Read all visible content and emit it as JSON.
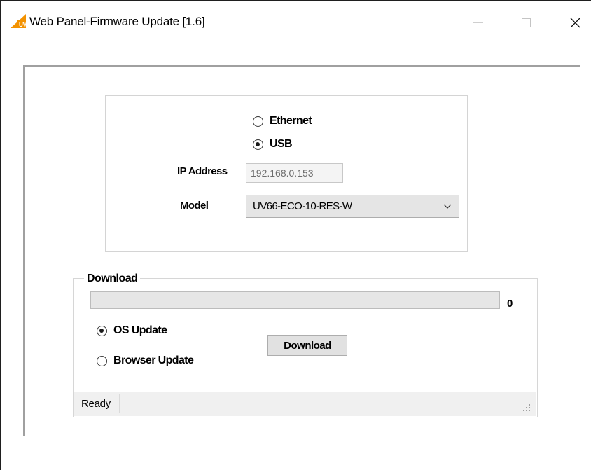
{
  "window": {
    "title": "Web Panel-Firmware Update [1.6]",
    "icon": "app-logo-icon",
    "controls": [
      "minimize-icon",
      "maximize-icon",
      "close-icon"
    ]
  },
  "connection": {
    "options": [
      {
        "label": "Ethernet",
        "selected": false
      },
      {
        "label": "USB",
        "selected": true
      }
    ],
    "ip_label": "IP Address",
    "ip_value": "192.168.0.153",
    "model_label": "Model",
    "model_value": "UV66-ECO-10-RES-W"
  },
  "download": {
    "group_label": "Download",
    "progress_value": "0",
    "progress_fraction": 0,
    "options": [
      {
        "label": "OS Update",
        "selected": true
      },
      {
        "label": "Browser Update",
        "selected": false
      }
    ],
    "button_label": "Download"
  },
  "status": {
    "text": "Ready"
  },
  "colors": {
    "progress_fill": "#06b025",
    "logo_orange": "#f39200"
  }
}
